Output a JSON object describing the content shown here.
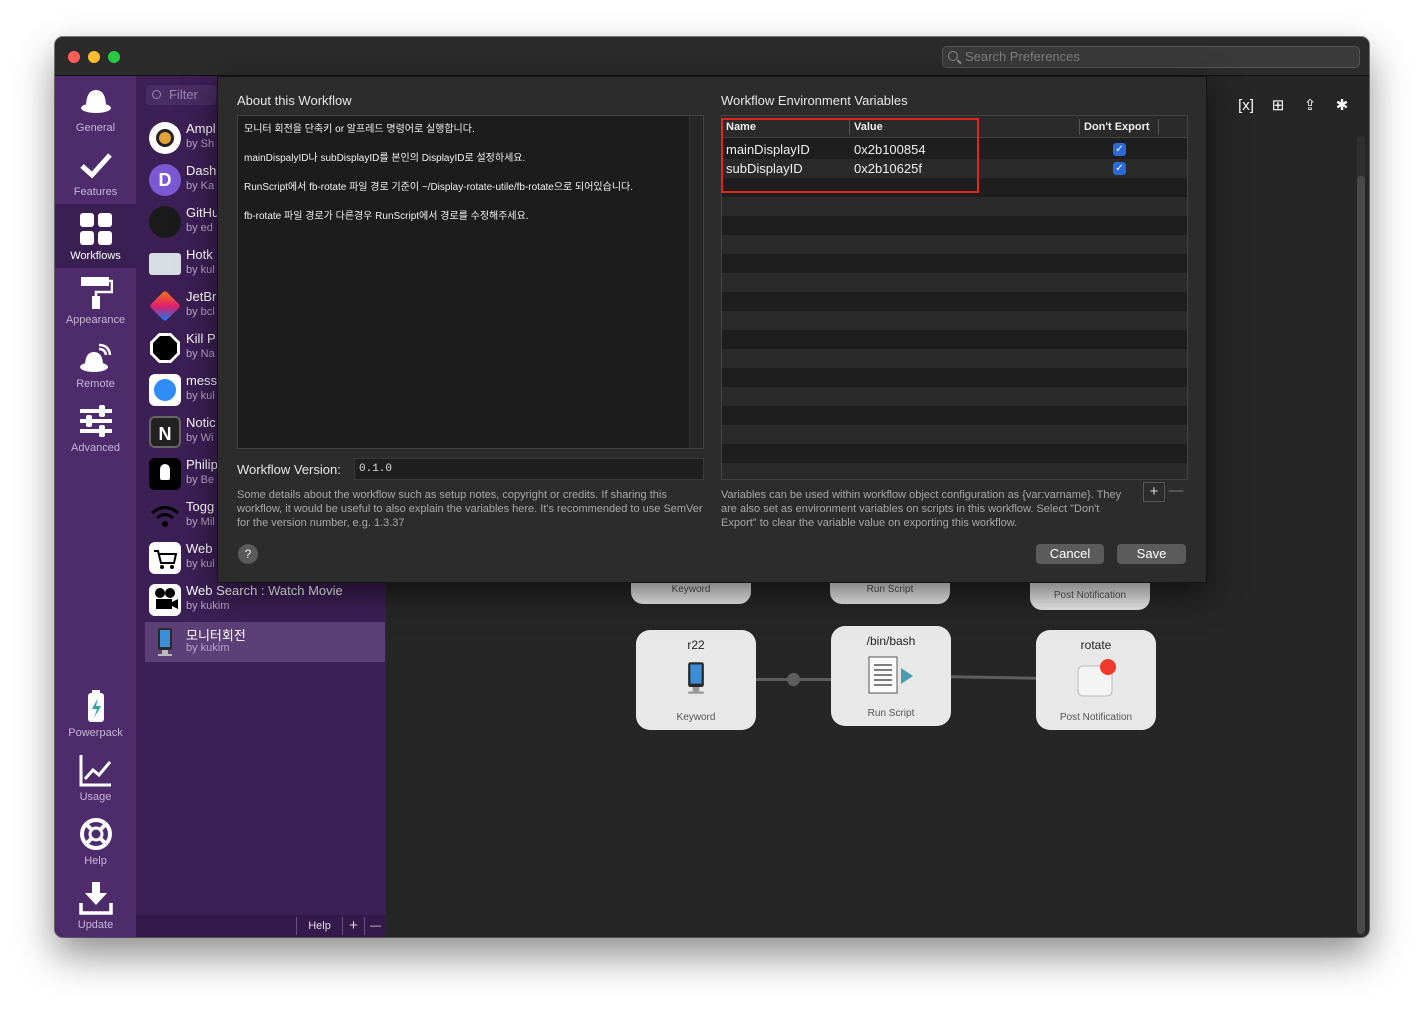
{
  "search": {
    "placeholder": "Search Preferences"
  },
  "sidebar": {
    "items": [
      {
        "label": "General",
        "icon": "hat-icon"
      },
      {
        "label": "Features",
        "icon": "checkmark-icon"
      },
      {
        "label": "Workflows",
        "icon": "grid-icon",
        "active": true
      },
      {
        "label": "Appearance",
        "icon": "paint-roller-icon"
      },
      {
        "label": "Remote",
        "icon": "remote-icon"
      },
      {
        "label": "Advanced",
        "icon": "sliders-icon"
      }
    ],
    "bottom_items": [
      {
        "label": "Powerpack",
        "icon": "battery-icon"
      },
      {
        "label": "Usage",
        "icon": "chart-icon"
      },
      {
        "label": "Help",
        "icon": "lifebuoy-icon"
      },
      {
        "label": "Update",
        "icon": "download-icon"
      }
    ]
  },
  "workflow_list": {
    "filter_placeholder": "Filter",
    "items": [
      {
        "name": "Ampl",
        "by": "by Sh"
      },
      {
        "name": "Dash",
        "by": "by Ka"
      },
      {
        "name": "GitHu",
        "by": "by ed"
      },
      {
        "name": "Hotk",
        "by": "by kul"
      },
      {
        "name": "JetBr",
        "by": "by bcl"
      },
      {
        "name": "Kill P",
        "by": "by Na"
      },
      {
        "name": "mess",
        "by": "by kul"
      },
      {
        "name": "Notic",
        "by": "by Wi"
      },
      {
        "name": "Philip",
        "by": "by Be"
      },
      {
        "name": "Togg",
        "by": "by Mil"
      },
      {
        "name": "Web",
        "by": "by kul"
      },
      {
        "name": "Web Search : Watch Movie",
        "by": "by kukim"
      },
      {
        "name": "모니터회전",
        "by": "by kukim",
        "active": true
      }
    ],
    "bottom": {
      "help": "Help",
      "add": "+",
      "remove": "—"
    }
  },
  "canvas": {
    "ghost_nodes": [
      "Keyword",
      "Run Script",
      "Post Notification"
    ],
    "nodes": [
      {
        "top": "r22",
        "bottom": "Keyword"
      },
      {
        "top": "/bin/bash",
        "bottom": "Run Script"
      },
      {
        "top": "rotate",
        "bottom": "Post Notification"
      }
    ]
  },
  "sheet": {
    "about_title": "About this Workflow",
    "about_lines": [
      "모니터 회전을 단축키 or 알프레드 명령어로 실행합니다.",
      "mainDispalyID나 subDisplayID를 본인의 DisplayID로 설정하세요.",
      "RunScript에서 fb-rotate 파일 경로 기준이 ~/Display-rotate-utile/fb-rotate으로 되어있습니다.",
      "fb-rotate 파일 경로가 다른경우 RunScript에서 경로를 수정해주세요."
    ],
    "version_label": "Workflow Version:",
    "version_value": "0.1.0",
    "about_help": "Some details about the workflow such as setup notes, copyright or credits. If sharing this workflow, it would be useful to also explain the variables here. It's recommended to use SemVer for the version number, e.g. 1.3.37",
    "env_title": "Workflow Environment Variables",
    "env_columns": {
      "name": "Name",
      "value": "Value",
      "dont_export": "Don't Export"
    },
    "env_rows": [
      {
        "name": "mainDisplayID",
        "value": "0x2b100854",
        "dont_export": true
      },
      {
        "name": "subDisplayID",
        "value": "0x2b10625f",
        "dont_export": true
      }
    ],
    "env_help": "Variables can be used within workflow object configuration as {var:varname}. They are also set as environment variables on scripts in this workflow. Select \"Don't Export\" to clear the variable value on exporting this workflow.",
    "add": "+",
    "remove": "—",
    "help_button": "?",
    "cancel": "Cancel",
    "save": "Save"
  }
}
